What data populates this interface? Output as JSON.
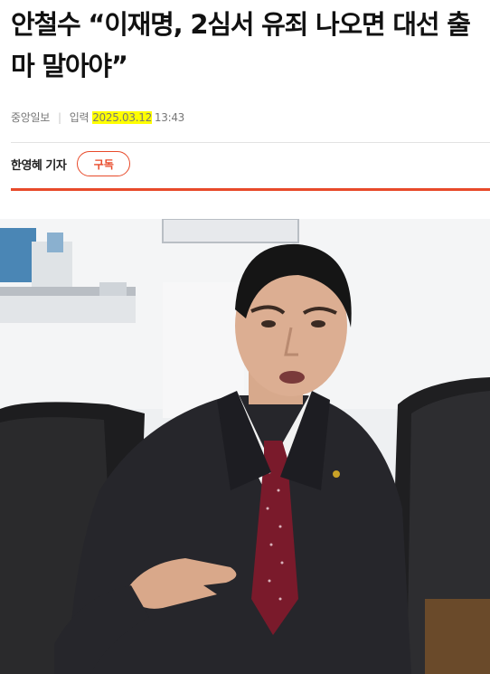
{
  "article": {
    "headline": "안철수 “이재명, 2심서 유죄 나오면 대선 출마 말아야”",
    "publisher": "중앙일보",
    "published_label": "입력",
    "published_date": "2025.03.12",
    "published_time": "13:43"
  },
  "byline": {
    "reporter": "한영혜 기자",
    "subscribe_label": "구독"
  },
  "colors": {
    "accent": "#e84a2a",
    "date_highlight": "#ffff00"
  },
  "photo": {
    "subject": "man-in-dark-suit-gesturing-portrait"
  }
}
